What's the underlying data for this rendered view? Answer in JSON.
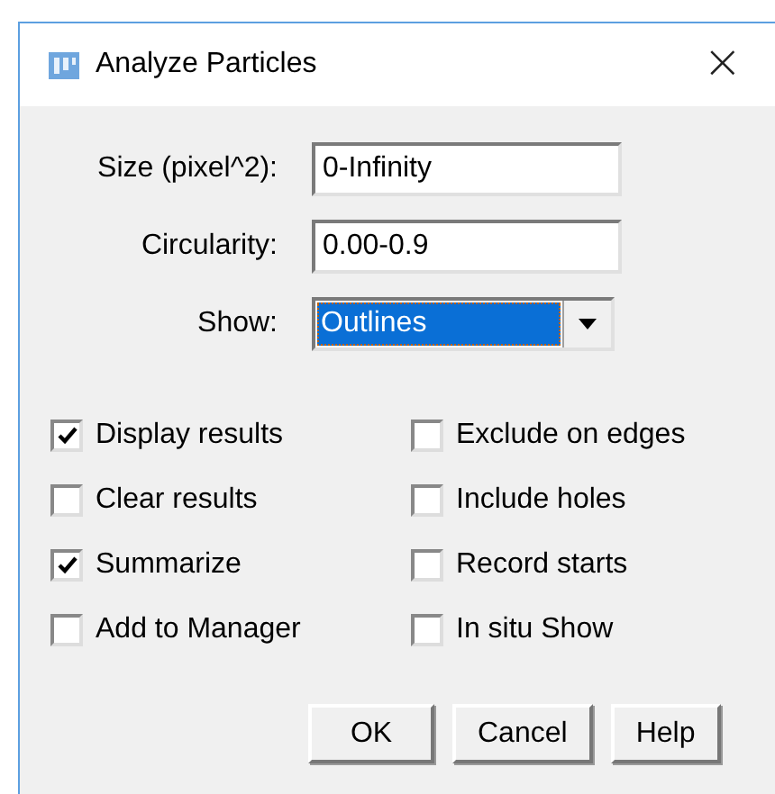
{
  "window": {
    "title": "Analyze Particles",
    "close": "×"
  },
  "fields": [
    {
      "label": "Size (pixel^2):",
      "value": "0-Infinity"
    },
    {
      "label": "Circularity:",
      "value": "0.00-0.9"
    }
  ],
  "show": {
    "label": "Show:",
    "value": "Outlines"
  },
  "options": [
    {
      "label": "Display results",
      "checked": true
    },
    {
      "label": "Exclude on edges",
      "checked": false
    },
    {
      "label": "Clear results",
      "checked": false
    },
    {
      "label": "Include holes",
      "checked": false
    },
    {
      "label": "Summarize",
      "checked": true
    },
    {
      "label": "Record starts",
      "checked": false
    },
    {
      "label": "Add to Manager",
      "checked": false
    },
    {
      "label": "In situ Show",
      "checked": false
    }
  ],
  "buttons": [
    "OK",
    "Cancel",
    "Help"
  ]
}
